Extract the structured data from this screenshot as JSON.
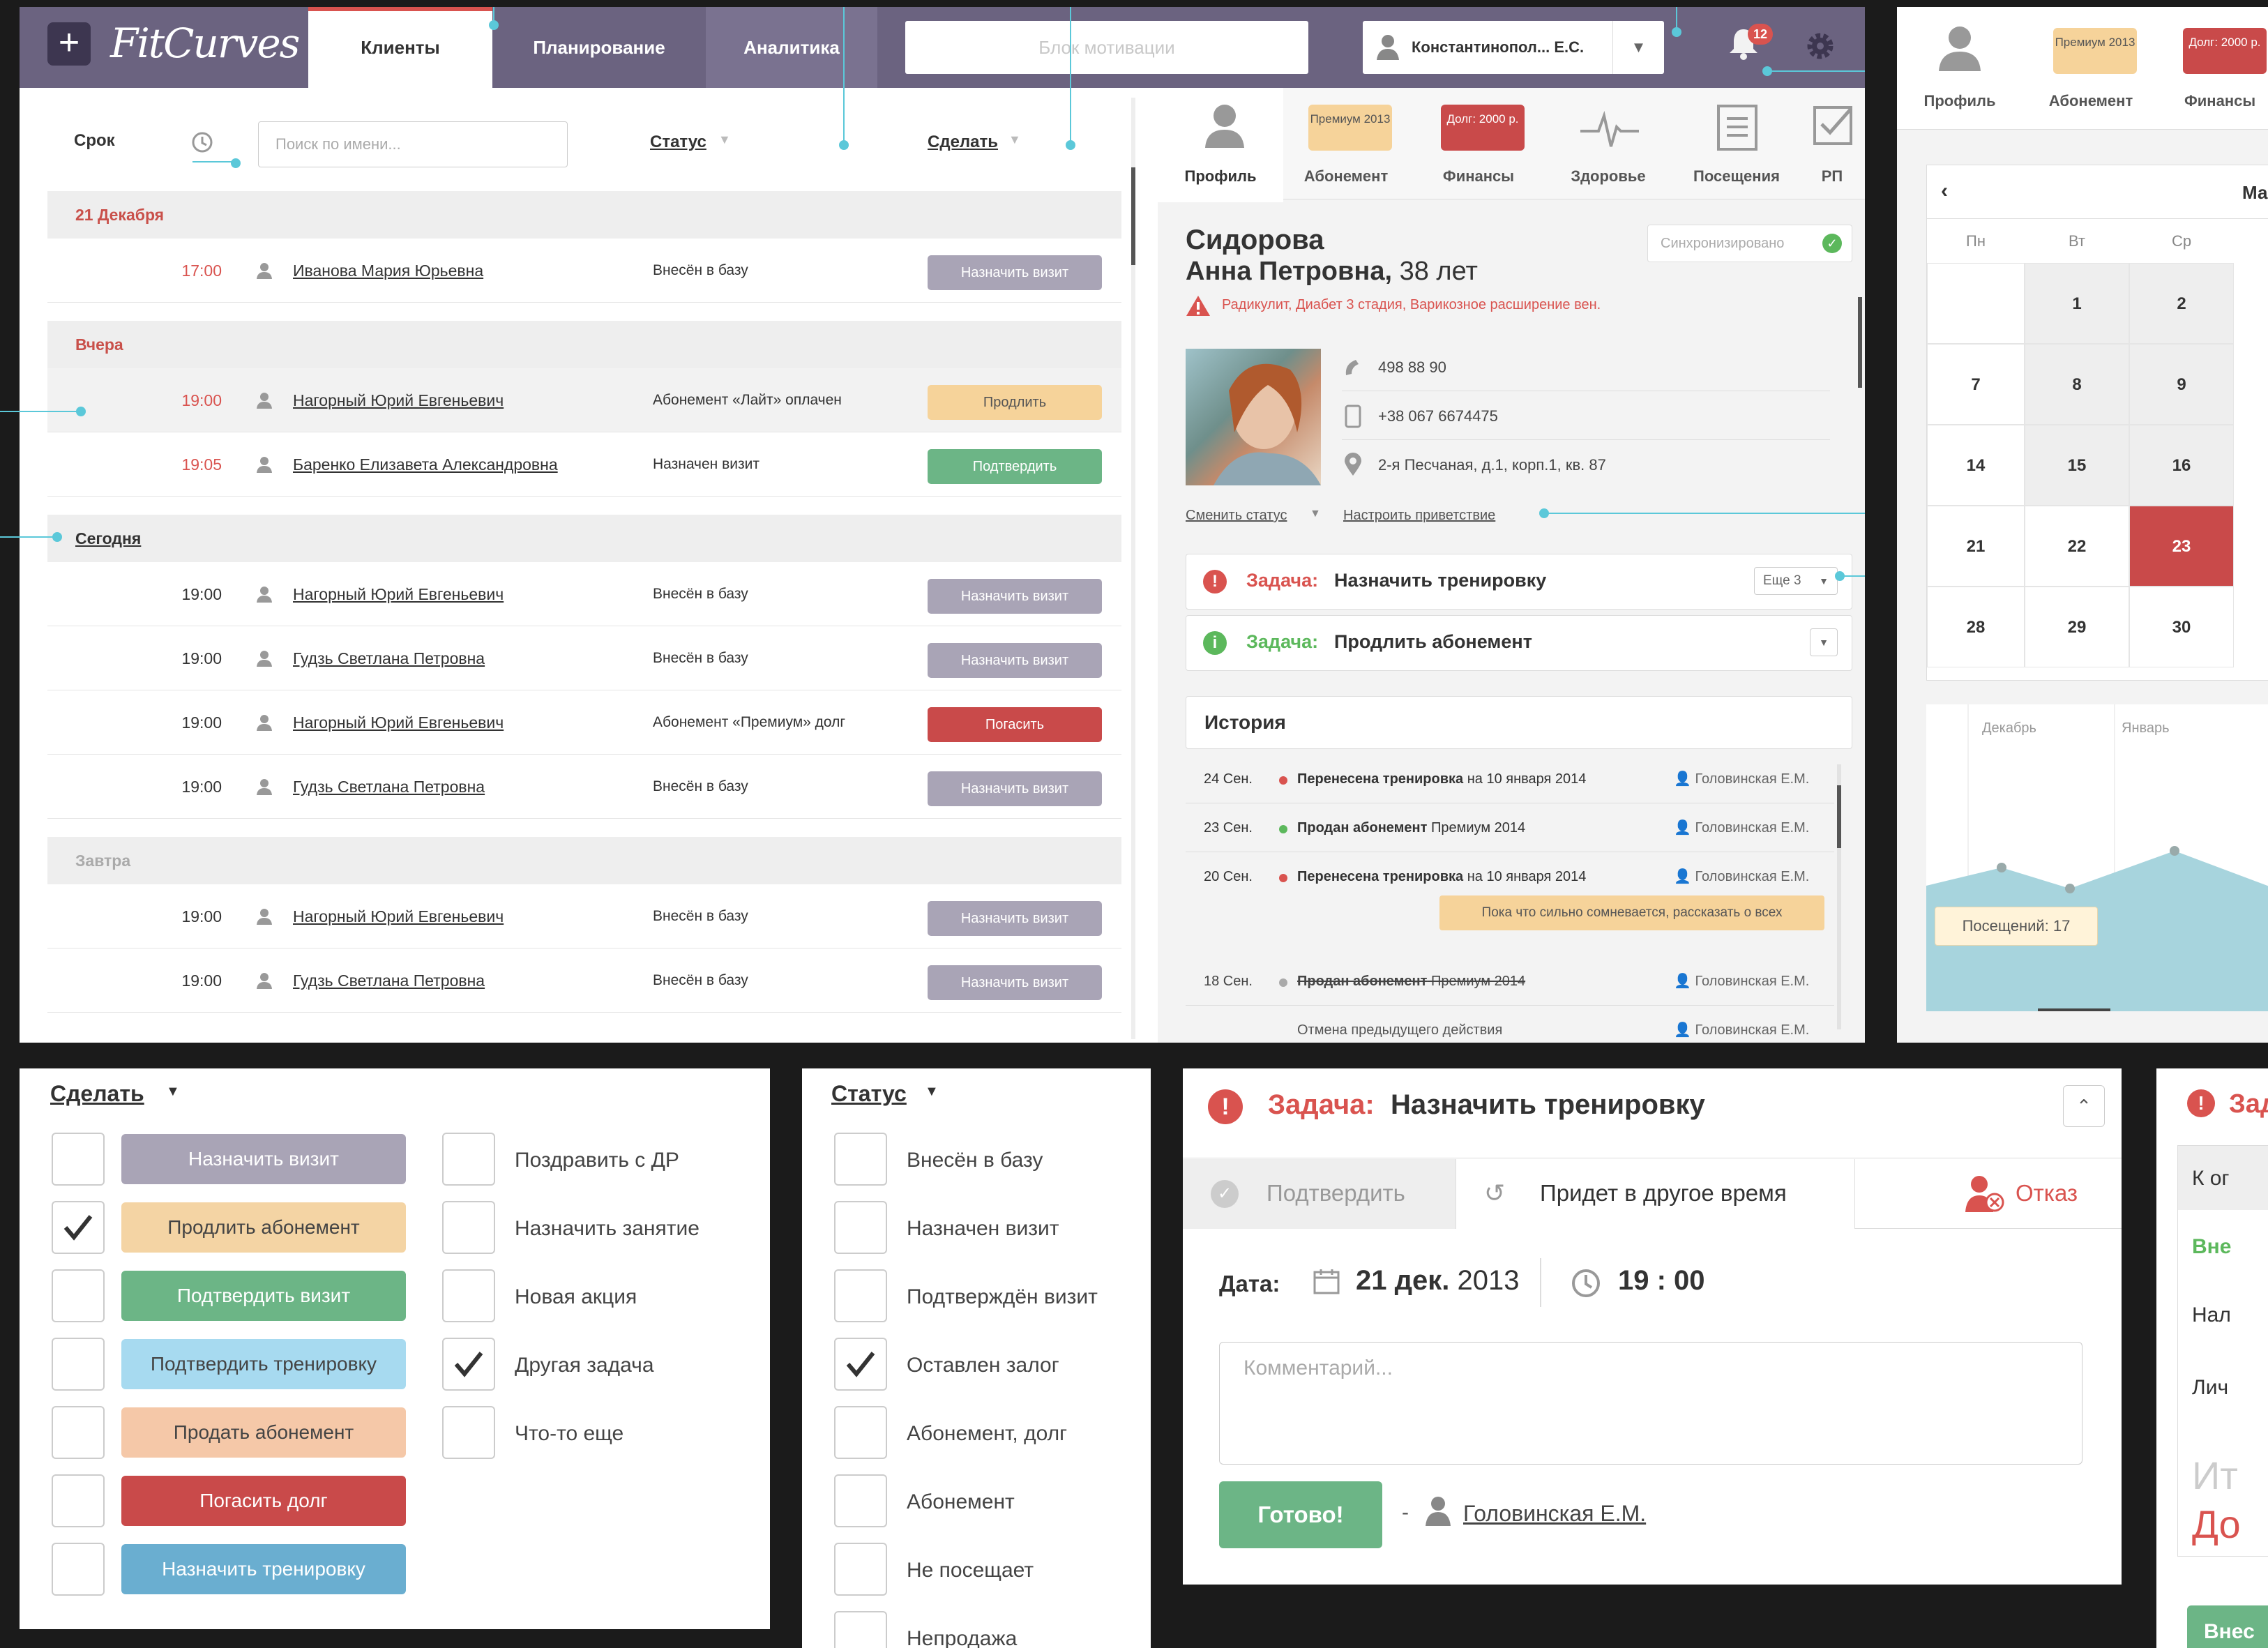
{
  "topbar": {
    "logo": "FitCurves",
    "tabs": [
      "Клиенты",
      "Планирование",
      "Аналитика"
    ],
    "motivation": "Блок мотивации",
    "user": "Константинопол... Е.С.",
    "notifications": "12"
  },
  "list": {
    "col_term": "Срок",
    "search_placeholder": "Поиск по имени...",
    "col_status": "Статус",
    "col_action": "Сделать",
    "groups": [
      {
        "title": "21 Декабря",
        "rows": [
          {
            "time": "17:00",
            "name": "Иванова Мария Юрьевна",
            "status": "Внесён в базу",
            "action": "Назначить визит"
          }
        ]
      },
      {
        "title": "Вчера",
        "rows": [
          {
            "time": "19:00",
            "name": "Нагорный Юрий Евгеньевич",
            "status": "Абонемент «Лайт» оплачен",
            "action": "Продлить"
          },
          {
            "time": "19:05",
            "name": "Баренко Елизавета Александровна",
            "status": "Назначен визит",
            "action": "Подтвердить"
          }
        ]
      },
      {
        "title": "Сегодня",
        "rows": [
          {
            "time": "19:00",
            "name": "Нагорный Юрий Евгеньевич",
            "status": "Внесён в базу",
            "action": "Назначить визит"
          },
          {
            "time": "19:00",
            "name": "Гудзь Светлана Петровна",
            "status": "Внесён в базу",
            "action": "Назначить визит"
          },
          {
            "time": "19:00",
            "name": "Нагорный Юрий Евгеньевич",
            "status": "Абонемент «Премиум» долг",
            "action": "Погасить"
          },
          {
            "time": "19:00",
            "name": "Гудзь Светлана Петровна",
            "status": "Внесён в базу",
            "action": "Назначить визит"
          }
        ]
      },
      {
        "title": "Завтра",
        "rows": [
          {
            "time": "19:00",
            "name": "Нагорный Юрий Евгеньевич",
            "status": "Внесён в базу",
            "action": "Назначить визит"
          },
          {
            "time": "19:00",
            "name": "Гудзь Светлана Петровна",
            "status": "Внесён в базу",
            "action": "Назначить визит"
          }
        ]
      }
    ]
  },
  "card": {
    "tabs": [
      "Профиль",
      "Абонемент",
      "Финансы",
      "Здоровье",
      "Посещения",
      "РП"
    ],
    "chip_premium": "Премиум 2013",
    "chip_debt": "Долг: 2000 р.",
    "surname": "Сидорова",
    "name": "Анна Петровна,",
    "age": "38 лет",
    "sync": "Синхронизировано",
    "warning": "Радикулит, Диабет 3 стадия, Варикозное расширение вен.",
    "phone": "498 88 90",
    "mobile": "+38 067 6674475",
    "address": "2-я Песчаная, д.1, корп.1, кв. 87",
    "change_status": "Сменить статус",
    "greeting": "Настроить приветствие",
    "task1_prefix": "Задача:",
    "task1": "Назначить тренировку",
    "task1_more": "Еще 3",
    "task2_prefix": "Задача:",
    "task2": "Продлить абонемент",
    "history_title": "История",
    "history": [
      {
        "date": "24 Сен.",
        "bold": "Перенесена тренировка",
        "rest": "на 10 января 2014",
        "user": "Головинская Е.М.",
        "dot": "#d9534f"
      },
      {
        "date": "23 Сен.",
        "bold": "Продан абонемент",
        "rest": "Премиум 2014",
        "user": "Головинская Е.М.",
        "dot": "#5cb85c"
      },
      {
        "date": "20 Сен.",
        "bold": "Перенесена тренировка",
        "rest": "на 10 января 2014",
        "user": "Головинская Е.М.",
        "dot": "#d9534f"
      },
      {
        "date": "18 Сен.",
        "bold": "Продан абонемент",
        "rest": "Премиум 2014",
        "user": "Головинская Е.М.",
        "dot": "#aaa"
      }
    ],
    "comment": "Пока что сильно сомневается, рассказать о всех",
    "undo": "Отмена предыдущего действия",
    "undo_user": "Головинская Е.М."
  },
  "calendar": {
    "tabs": [
      "Профиль",
      "Абонемент",
      "Финансы"
    ],
    "chip_premium": "Премиум 2013",
    "chip_debt": "Долг: 2000 р.",
    "month": "Ма",
    "days": [
      "Пн",
      "Вт",
      "Ср"
    ],
    "weeks": [
      [
        "",
        "1",
        "2"
      ],
      [
        "7",
        "8",
        "9"
      ],
      [
        "14",
        "15",
        "16"
      ],
      [
        "21",
        "22",
        "23"
      ],
      [
        "28",
        "29",
        "30"
      ]
    ],
    "chart_labels": [
      "Декабрь",
      "Январь"
    ],
    "tooltip": "Посещений:  17"
  },
  "chart_data": {
    "type": "area",
    "x": [
      "",
      "Декабрь",
      "",
      "Январь",
      ""
    ],
    "values": [
      null,
      null,
      null,
      null,
      null
    ],
    "tooltip": "Посещений: 17"
  },
  "todo": {
    "title": "Сделать",
    "left": [
      {
        "label": "Назначить визит",
        "color": "#a9a4b6",
        "checked": false
      },
      {
        "label": "Продлить абонемент",
        "color": "#f4d4a4",
        "checked": true,
        "dark": true
      },
      {
        "label": "Подтвердить визит",
        "color": "#6cb586",
        "checked": false
      },
      {
        "label": "Подтвердить тренировку",
        "color": "#a7daf0",
        "checked": false,
        "dark": true
      },
      {
        "label": "Продать абонемент",
        "color": "#f5c8a8",
        "checked": false,
        "dark": true
      },
      {
        "label": "Погасить долг",
        "color": "#c94a4a",
        "checked": false
      },
      {
        "label": "Назначить тренировку",
        "color": "#6aaed0",
        "checked": false
      }
    ],
    "right": [
      {
        "label": "Поздравить с ДР",
        "checked": false
      },
      {
        "label": "Назначить занятие",
        "checked": false
      },
      {
        "label": "Новая акция",
        "checked": false
      },
      {
        "label": "Другая задача",
        "checked": true
      },
      {
        "label": "Что-то еще",
        "checked": false
      }
    ]
  },
  "status": {
    "title": "Статус",
    "items": [
      {
        "label": "Внесён в базу",
        "checked": false
      },
      {
        "label": "Назначен визит",
        "checked": false
      },
      {
        "label": "Подтверждён визит",
        "checked": false
      },
      {
        "label": "Оставлен залог",
        "checked": true
      },
      {
        "label": "Абонемент, долг",
        "checked": false
      },
      {
        "label": "Абонемент",
        "checked": false
      },
      {
        "label": "Не посещает",
        "checked": false
      },
      {
        "label": "Непродажа",
        "checked": false
      }
    ]
  },
  "task": {
    "prefix": "Задача:",
    "title": "Назначить тренировку",
    "tab_confirm": "Подтвердить",
    "tab_other": "Придет в другое время",
    "refuse": "Отказ",
    "date_label": "Дата:",
    "date": "21 дек.",
    "year": "2013",
    "time": "19 : 00",
    "comment_placeholder": "Комментарий...",
    "done": "Готово!",
    "user": "Головинская Е.М."
  },
  "partial": {
    "prefix": "Зад",
    "l1": "К ог",
    "l2": "Вне",
    "l3": "Нал",
    "l4": "Лич",
    "l5": "Ит",
    "l6": "До",
    "btn": "Внес"
  }
}
